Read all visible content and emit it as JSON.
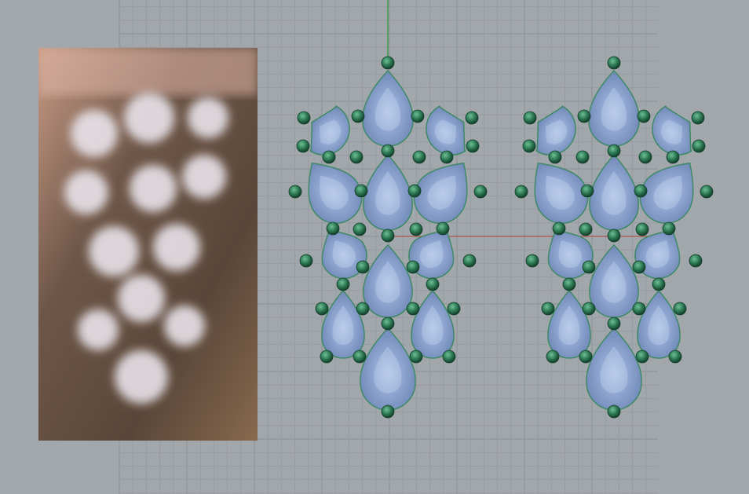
{
  "viewport": {
    "background": "#a2a7ac",
    "grid_minor": "#979ca1",
    "grid_major": "#8c9196",
    "x_axis_color": "#b04040",
    "y_axis_color": "#3d9a4a"
  },
  "model": {
    "gem_color": "#7f97c4",
    "gem_highlight": "#b3c6e6",
    "gem_outline": "#3e8a66",
    "bead_color": "#2f7a57",
    "earring_count": 2
  }
}
